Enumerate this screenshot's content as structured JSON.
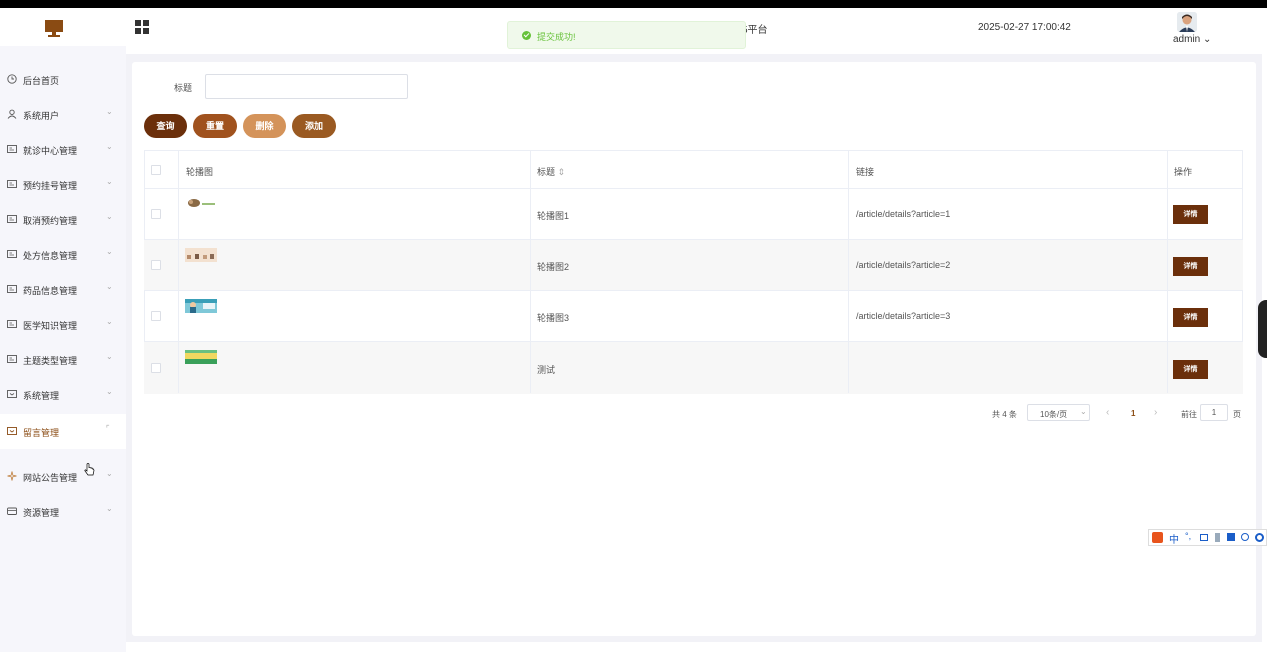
{
  "header": {
    "site_title_fragment": "5平台",
    "datetime": "2025-02-27 17:00:42",
    "user": "admin",
    "user_caret": "⌄"
  },
  "toast": {
    "message": "提交成功!"
  },
  "sidebar": {
    "items": [
      {
        "label": "后台首页",
        "icon": "clock-icon",
        "arrow": ""
      },
      {
        "label": "系统用户",
        "icon": "user-icon",
        "arrow": "⌄"
      },
      {
        "label": "就诊中心管理",
        "icon": "menu-box-icon",
        "arrow": "⌄"
      },
      {
        "label": "预约挂号管理",
        "icon": "menu-box-icon",
        "arrow": "⌄"
      },
      {
        "label": "取消预约管理",
        "icon": "menu-box-icon",
        "arrow": "⌄"
      },
      {
        "label": "处方信息管理",
        "icon": "menu-box-icon",
        "arrow": "⌄"
      },
      {
        "label": "药品信息管理",
        "icon": "menu-box-icon",
        "arrow": "⌄"
      },
      {
        "label": "医学知识管理",
        "icon": "menu-box-icon",
        "arrow": "⌄"
      },
      {
        "label": "主题类型管理",
        "icon": "menu-box-icon",
        "arrow": "⌄"
      },
      {
        "label": "系统管理",
        "icon": "folder-icon",
        "arrow": "⌄"
      },
      {
        "label": "留言管理",
        "icon": "folder-icon",
        "arrow": "⌜"
      },
      {
        "label": "网站公告管理",
        "icon": "sparkle-icon",
        "arrow": "⌄"
      },
      {
        "label": "资源管理",
        "icon": "box-icon",
        "arrow": "⌄"
      }
    ]
  },
  "search": {
    "label": "标题",
    "value": "",
    "placeholder": ""
  },
  "buttons": {
    "query": "查询",
    "reset": "重置",
    "delete": "删除",
    "add": "添加"
  },
  "colors": {
    "query": "#6b2f0b",
    "reset": "#a0521e",
    "delete": "#d4935a",
    "add": "#9a5a22",
    "detail": "#6b2f0b"
  },
  "table": {
    "headers": {
      "image": "轮播图",
      "title": "标题",
      "sort_icon": "⇕",
      "link": "链接",
      "action": "操作"
    },
    "rows": [
      {
        "title": "轮播图1",
        "link": "/article/details?article=1",
        "action": "详情",
        "image": "banner-thumb-1"
      },
      {
        "title": "轮播图2",
        "link": "/article/details?article=2",
        "action": "详情",
        "image": "banner-thumb-2"
      },
      {
        "title": "轮播图3",
        "link": "/article/details?article=3",
        "action": "详情",
        "image": "banner-thumb-3"
      },
      {
        "title": "测试",
        "link": "",
        "action": "详情",
        "image": "banner-thumb-4"
      }
    ]
  },
  "pager": {
    "total": "共 4 条",
    "page_size": "10条/页",
    "page_size_caret": "⌄",
    "prev": "‹",
    "current": "1",
    "next": "›",
    "goto_label": "前往",
    "goto_value": "1",
    "page_unit": "页"
  },
  "ime": {
    "lang": "中",
    "icons": [
      "sogou-icon",
      "punct-icon",
      "keyboard-icon",
      "user-icon",
      "shirt-icon",
      "settings-icon",
      "gear-icon"
    ]
  }
}
